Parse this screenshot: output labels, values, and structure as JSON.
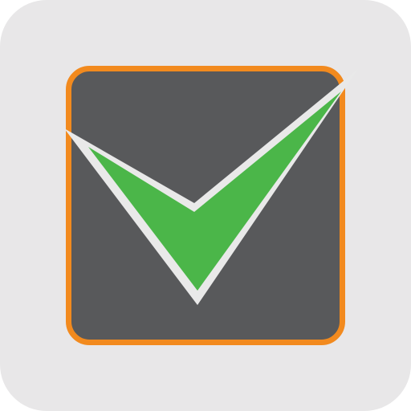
{
  "icon": {
    "name": "checkbox-checkmark-app-icon",
    "colors": {
      "tile_background": "#e8e7e8",
      "box_border": "#f28a1e",
      "box_fill": "#58595b",
      "check_outline": "#e9e9e9",
      "check_fill": "#4bb649"
    }
  }
}
